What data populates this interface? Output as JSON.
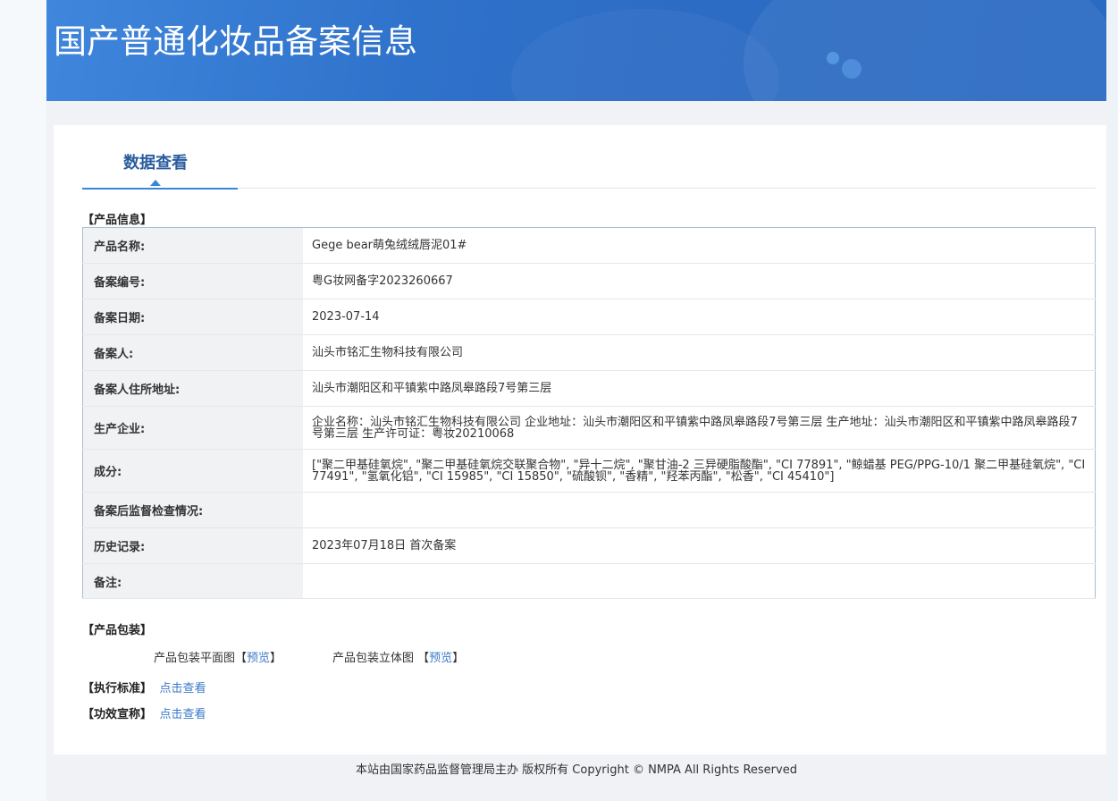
{
  "header": {
    "title": "国产普通化妆品备案信息"
  },
  "tabs": [
    {
      "label": "数据查看"
    }
  ],
  "product_info": {
    "section_title": "【产品信息】",
    "rows": [
      {
        "label": "产品名称:",
        "value": "Gege bear萌兔绒绒唇泥01#"
      },
      {
        "label": "备案编号:",
        "value": "粤G妆网备字2023260667"
      },
      {
        "label": "备案日期:",
        "value": "2023-07-14"
      },
      {
        "label": "备案人:",
        "value": "汕头市铭汇生物科技有限公司"
      },
      {
        "label": "备案人住所地址:",
        "value": "汕头市潮阳区和平镇紫中路凤皋路段7号第三层"
      },
      {
        "label": "生产企业:",
        "value": "企业名称：汕头市铭汇生物科技有限公司 企业地址：汕头市潮阳区和平镇紫中路凤皋路段7号第三层 生产地址：汕头市潮阳区和平镇紫中路凤皋路段7号第三层 生产许可证：粤妆20210068"
      },
      {
        "label": "成分:",
        "value": "[\"聚二甲基硅氧烷\", \"聚二甲基硅氧烷交联聚合物\", \"异十二烷\", \"聚甘油-2 三异硬脂酸酯\", \"CI 77891\", \"鲸蜡基 PEG/PPG-10/1 聚二甲基硅氧烷\", \"CI 77491\", \"氢氧化铝\", \"CI 15985\", \"CI 15850\", \"硫酸钡\", \"香精\", \"羟苯丙酯\", \"松香\", \"CI 45410\"]"
      },
      {
        "label": "备案后监督检查情况:",
        "value": ""
      },
      {
        "label": "历史记录:",
        "value": "2023年07月18日 首次备案"
      },
      {
        "label": "备注:",
        "value": ""
      }
    ]
  },
  "packaging": {
    "section_title": "【产品包装】",
    "flat_label": "产品包装平面图",
    "flat_link": "预览",
    "solid_label": "产品包装立体图",
    "solid_link": "预览",
    "bracket_open": "【",
    "bracket_close": "】"
  },
  "standard": {
    "section_title": "【执行标准】",
    "link": "点击查看"
  },
  "efficacy": {
    "section_title": "【功效宣称】",
    "link": "点击查看"
  },
  "footer": {
    "text": "本站由国家药品监督管理局主办 版权所有 Copyright © NMPA All Rights Reserved"
  }
}
